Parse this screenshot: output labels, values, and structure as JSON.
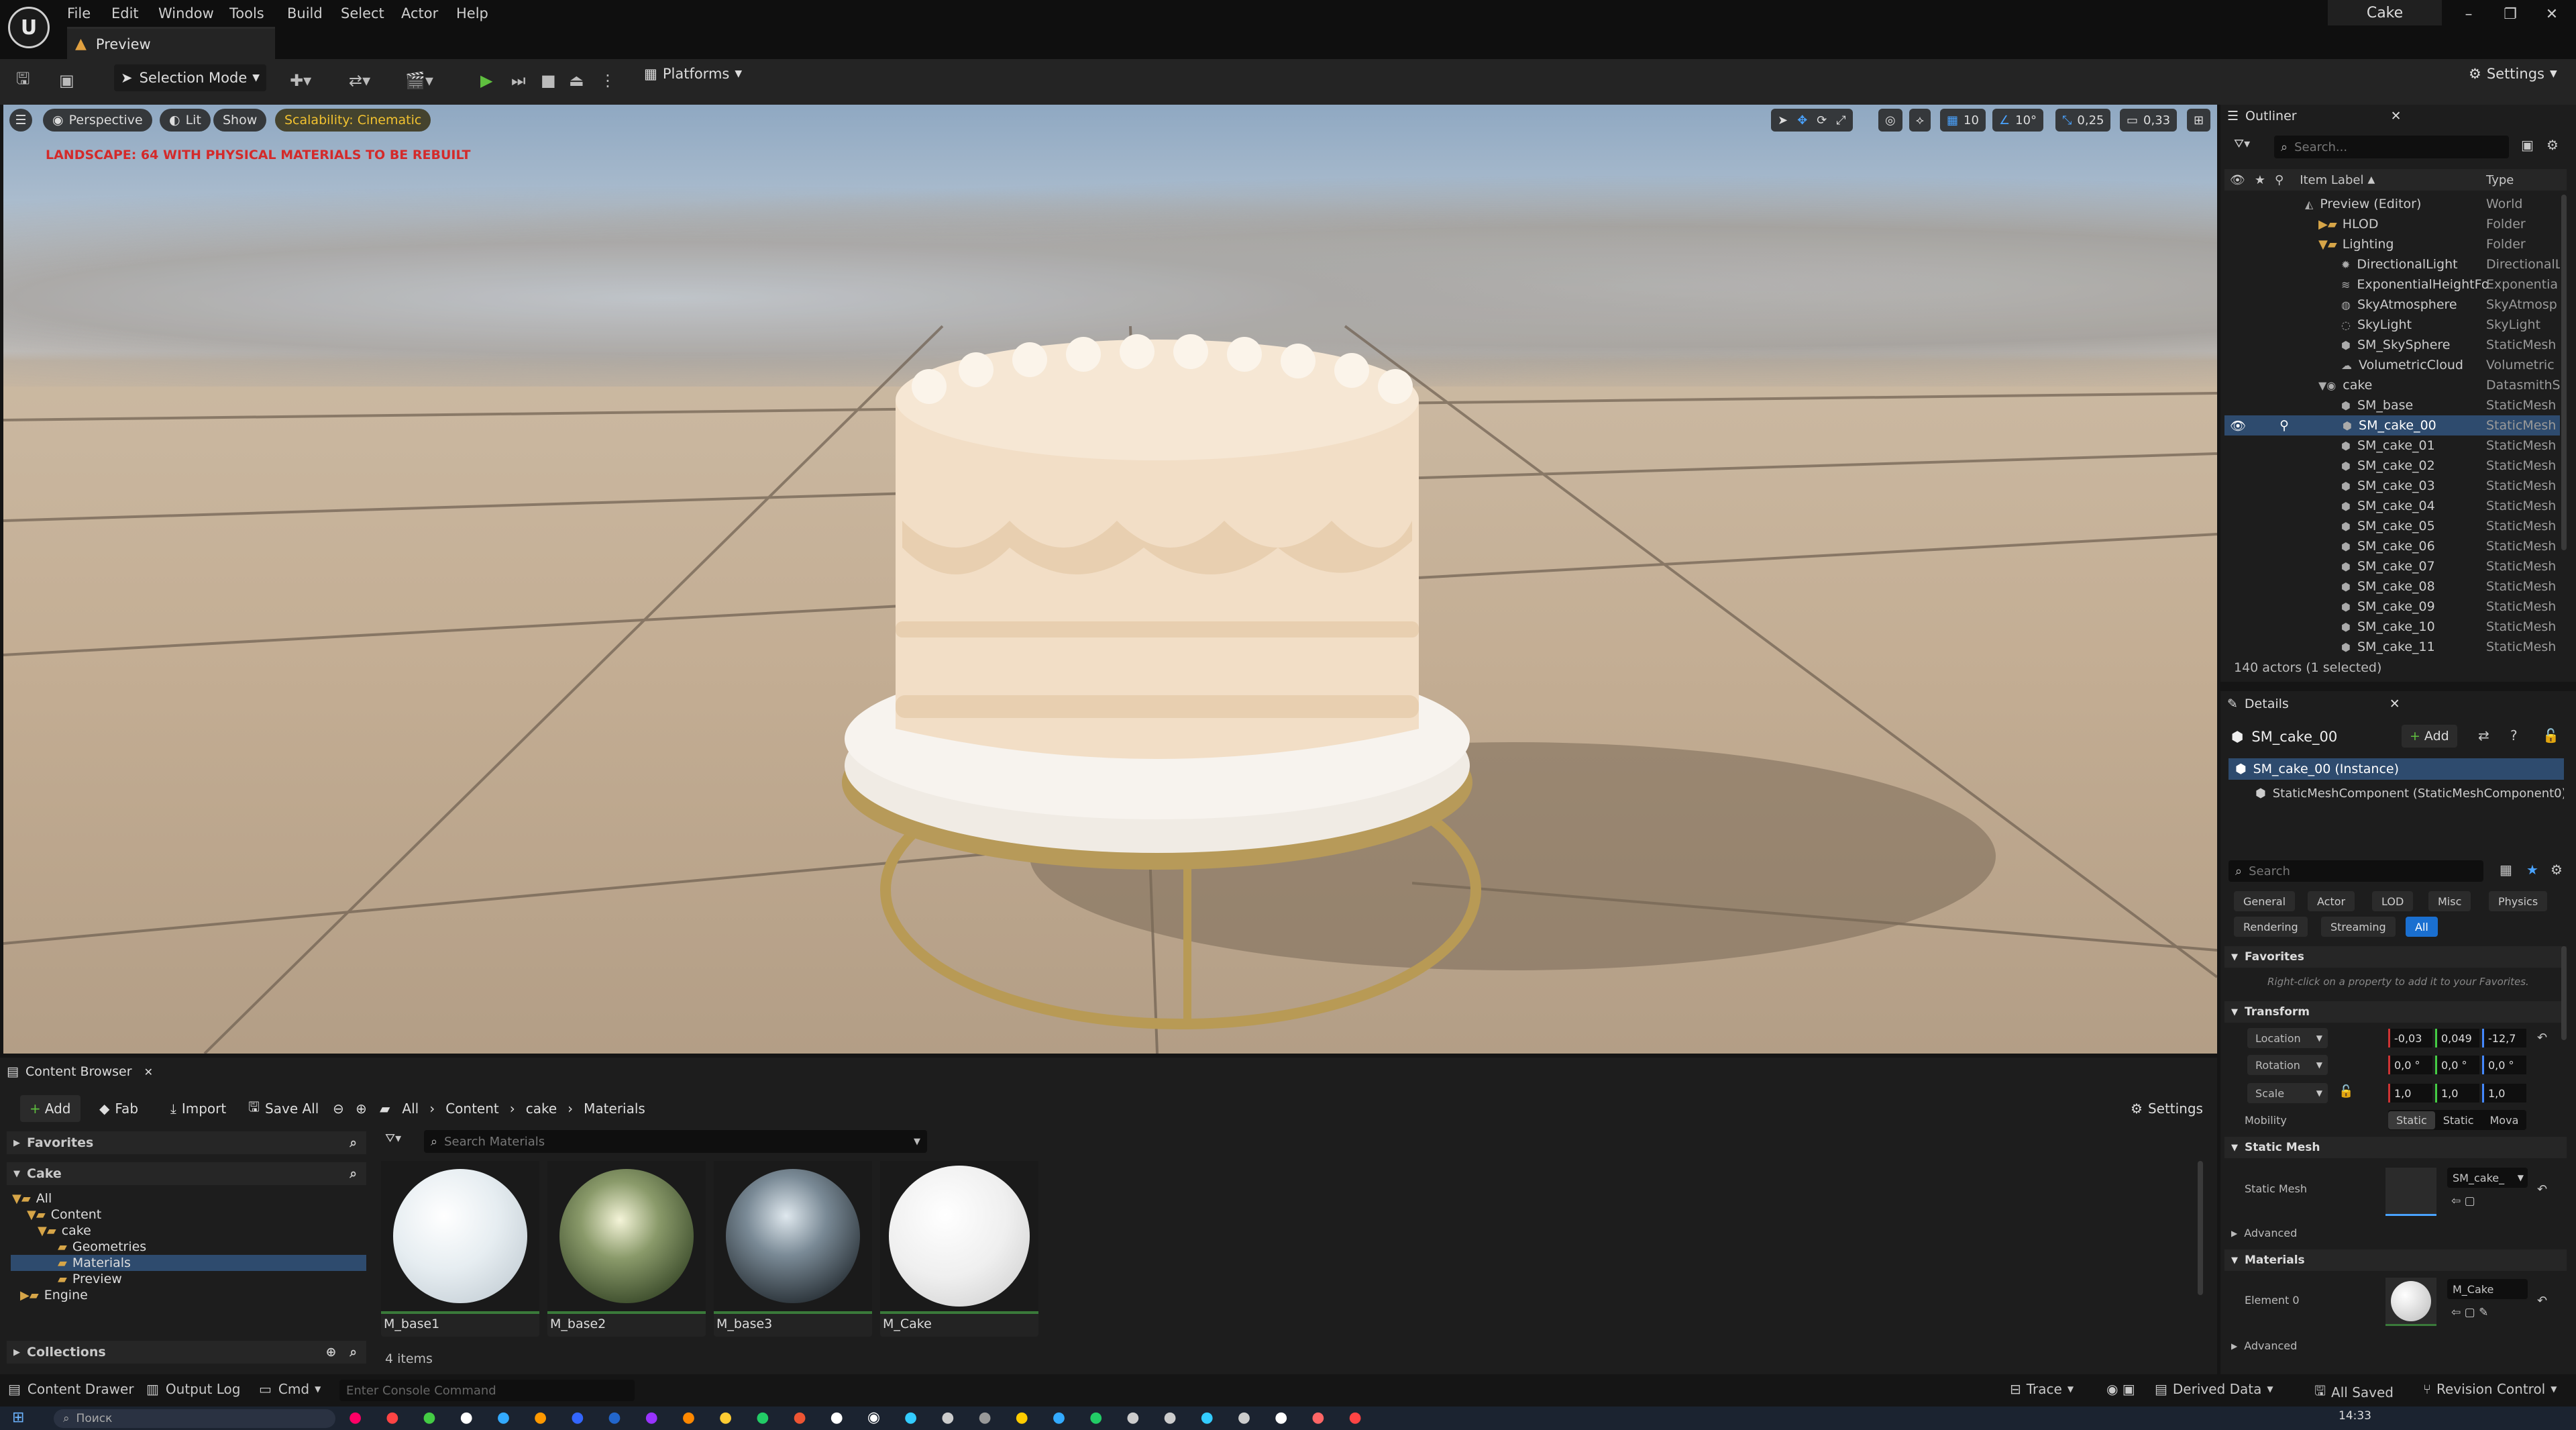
{
  "titlebar": {
    "menu": [
      "File",
      "Edit",
      "Window",
      "Tools",
      "Build",
      "Select",
      "Actor",
      "Help"
    ],
    "doc_tab": "Preview",
    "project": "Cake"
  },
  "toolbar": {
    "selection_mode": "Selection Mode",
    "platforms": "Platforms",
    "settings": "Settings"
  },
  "viewport": {
    "perspective": "Perspective",
    "lit": "Lit",
    "show": "Show",
    "scalability": "Scalability: Cinematic",
    "warning": "LANDSCAPE: 64  WITH PHYSICAL MATERIALS  TO BE REBUILT",
    "grid_snap": "10",
    "rot_snap": "10°",
    "scale_snap": "0,25",
    "camera_speed": "0,33"
  },
  "outliner": {
    "title": "Outliner",
    "search_placeholder": "Search...",
    "col_label": "Item Label",
    "col_type": "Type",
    "rows": [
      {
        "label": "Preview (Editor)",
        "type": "World"
      },
      {
        "label": "HLOD",
        "type": "Folder"
      },
      {
        "label": "Lighting",
        "type": "Folder"
      },
      {
        "label": "DirectionalLight",
        "type": "DirectionalL"
      },
      {
        "label": "ExponentialHeightFo",
        "type": "Exponentia"
      },
      {
        "label": "SkyAtmosphere",
        "type": "SkyAtmosp"
      },
      {
        "label": "SkyLight",
        "type": "SkyLight"
      },
      {
        "label": "SM_SkySphere",
        "type": "StaticMesh"
      },
      {
        "label": "VolumetricCloud",
        "type": "Volumetric"
      },
      {
        "label": "cake",
        "type": "DatasmithS"
      },
      {
        "label": "SM_base",
        "type": "StaticMesh"
      },
      {
        "label": "SM_cake_00",
        "type": "StaticMesh"
      },
      {
        "label": "SM_cake_01",
        "type": "StaticMesh"
      },
      {
        "label": "SM_cake_02",
        "type": "StaticMesh"
      },
      {
        "label": "SM_cake_03",
        "type": "StaticMesh"
      },
      {
        "label": "SM_cake_04",
        "type": "StaticMesh"
      },
      {
        "label": "SM_cake_05",
        "type": "StaticMesh"
      },
      {
        "label": "SM_cake_06",
        "type": "StaticMesh"
      },
      {
        "label": "SM_cake_07",
        "type": "StaticMesh"
      },
      {
        "label": "SM_cake_08",
        "type": "StaticMesh"
      },
      {
        "label": "SM_cake_09",
        "type": "StaticMesh"
      },
      {
        "label": "SM_cake_10",
        "type": "StaticMesh"
      },
      {
        "label": "SM_cake_11",
        "type": "StaticMesh"
      }
    ],
    "footer": "140 actors (1 selected)"
  },
  "details": {
    "title": "Details",
    "actor": "SM_cake_00",
    "add": "Add",
    "instance": "SM_cake_00 (Instance)",
    "component": "StaticMeshComponent (StaticMeshComponent0)",
    "search_placeholder": "Search",
    "categories": [
      "General",
      "Actor",
      "LOD",
      "Misc",
      "Physics",
      "Rendering",
      "Streaming",
      "All"
    ],
    "favorites": "Favorites",
    "favorites_hint": "Right-click on a property to add it to your Favorites.",
    "transform": "Transform",
    "location": "Location",
    "rotation": "Rotation",
    "scale": "Scale",
    "loc_vals": [
      "-0,03",
      "0,049",
      "-12,7"
    ],
    "rot_vals": [
      "0,0 °",
      "0,0 °",
      "0,0 °"
    ],
    "scale_vals": [
      "1,0",
      "1,0",
      "1,0"
    ],
    "mobility": "Mobility",
    "mobility_opts": [
      "Static",
      "Static",
      "Mova"
    ],
    "static_mesh_section": "Static Mesh",
    "static_mesh_label": "Static Mesh",
    "static_mesh_val": "SM_cake_",
    "advanced": "Advanced",
    "materials": "Materials",
    "element0": "Element 0",
    "element0_val": "M_Cake"
  },
  "content_browser": {
    "title": "Content Browser",
    "add": "Add",
    "fab": "Fab",
    "import": "Import",
    "save_all": "Save All",
    "breadcrumb": [
      "All",
      "Content",
      "cake",
      "Materials"
    ],
    "settings": "Settings",
    "favorites": "Favorites",
    "project": "Cake",
    "tree": [
      "All",
      "Content",
      "cake",
      "Geometries",
      "Materials",
      "Preview",
      "Engine"
    ],
    "collections": "Collections",
    "search_placeholder": "Search Materials",
    "assets": [
      "M_base1",
      "M_base2",
      "M_base3",
      "M_Cake"
    ],
    "count": "4 items"
  },
  "status": {
    "content_drawer": "Content Drawer",
    "output_log": "Output Log",
    "cmd": "Cmd",
    "console_placeholder": "Enter Console Command",
    "trace": "Trace",
    "derived_data": "Derived Data",
    "all_saved": "All Saved",
    "revision_control": "Revision Control"
  },
  "taskbar": {
    "search_placeholder": "Поиск",
    "time": "14:33"
  }
}
